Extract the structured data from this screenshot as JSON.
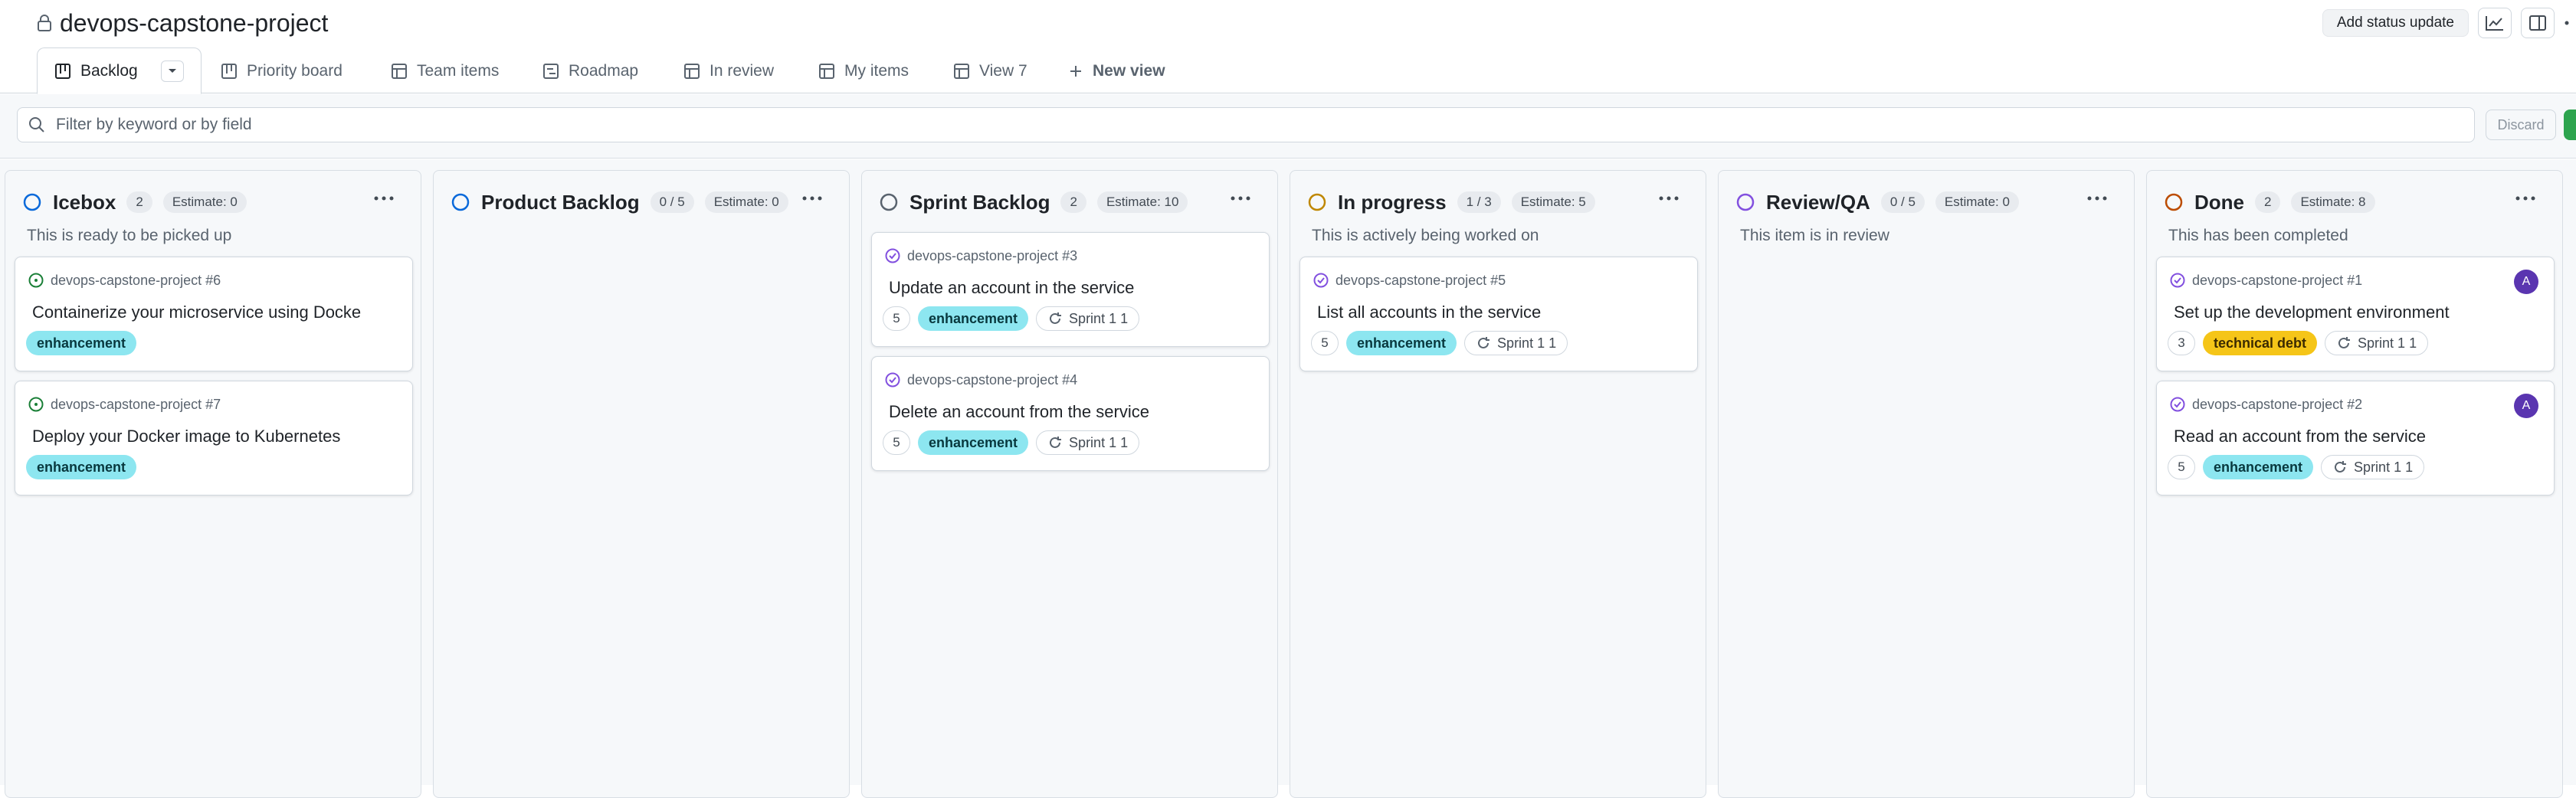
{
  "header": {
    "title": "devops-capstone-project",
    "status_update_label": "Add status update"
  },
  "tabs": [
    {
      "label": "Backlog",
      "active": true,
      "icon": "board-icon"
    },
    {
      "label": "Priority board",
      "icon": "board-icon"
    },
    {
      "label": "Team items",
      "icon": "table-icon"
    },
    {
      "label": "Roadmap",
      "icon": "roadmap-icon"
    },
    {
      "label": "In review",
      "icon": "table-icon"
    },
    {
      "label": "My items",
      "icon": "table-icon"
    },
    {
      "label": "View 7",
      "icon": "table-icon"
    }
  ],
  "new_view_label": "New view",
  "filter": {
    "placeholder": "Filter by keyword or by field",
    "discard_label": "Discard"
  },
  "colors": {
    "icebox": "#0969da",
    "product_backlog": "#0969da",
    "sprint_backlog": "#59636e",
    "in_progress": "#bf8700",
    "review_qa": "#8250df",
    "done": "#bc4c00",
    "open_issue": "#1a7f37",
    "closed_issue": "#8250df",
    "label_enhancement": "#8de6f0",
    "label_technical_debt": "#f5c518"
  },
  "columns": [
    {
      "name": "Icebox",
      "count": "2",
      "estimate": "Estimate: 0",
      "description": "This is ready to be picked up",
      "cards": [
        {
          "ref": "devops-capstone-project #6",
          "title": "Containerize your microservice using Docke",
          "status": "open",
          "labels": [
            "enhancement"
          ]
        },
        {
          "ref": "devops-capstone-project #7",
          "title": "Deploy your Docker image to Kubernetes",
          "status": "open",
          "labels": [
            "enhancement"
          ]
        }
      ]
    },
    {
      "name": "Product Backlog",
      "count": "0 / 5",
      "estimate": "Estimate: 0",
      "description": "",
      "cards": []
    },
    {
      "name": "Sprint Backlog",
      "count": "2",
      "estimate": "Estimate: 10",
      "description": "",
      "cards": [
        {
          "ref": "devops-capstone-project #3",
          "title": "Update an account in the service",
          "status": "closed",
          "points": "5",
          "labels": [
            "enhancement"
          ],
          "iteration": "Sprint 1 1"
        },
        {
          "ref": "devops-capstone-project #4",
          "title": "Delete an account from the service",
          "status": "closed",
          "points": "5",
          "labels": [
            "enhancement"
          ],
          "iteration": "Sprint 1 1"
        }
      ]
    },
    {
      "name": "In progress",
      "count": "1 / 3",
      "estimate": "Estimate: 5",
      "description": "This is actively being worked on",
      "cards": [
        {
          "ref": "devops-capstone-project #5",
          "title": "List all accounts in the service",
          "status": "closed",
          "points": "5",
          "labels": [
            "enhancement"
          ],
          "iteration": "Sprint 1 1"
        }
      ]
    },
    {
      "name": "Review/QA",
      "count": "0 / 5",
      "estimate": "Estimate: 0",
      "description": "This item is in review",
      "cards": []
    },
    {
      "name": "Done",
      "count": "2",
      "estimate": "Estimate: 8",
      "description": "This has been completed",
      "cards": [
        {
          "ref": "devops-capstone-project #1",
          "title": "Set up the development environment",
          "status": "closed",
          "points": "3",
          "labels": [
            "technical debt"
          ],
          "iteration": "Sprint 1 1",
          "assignee": "A"
        },
        {
          "ref": "devops-capstone-project #2",
          "title": "Read an account from the service",
          "status": "closed",
          "points": "5",
          "labels": [
            "enhancement"
          ],
          "iteration": "Sprint 1 1",
          "assignee": "A"
        }
      ]
    }
  ]
}
